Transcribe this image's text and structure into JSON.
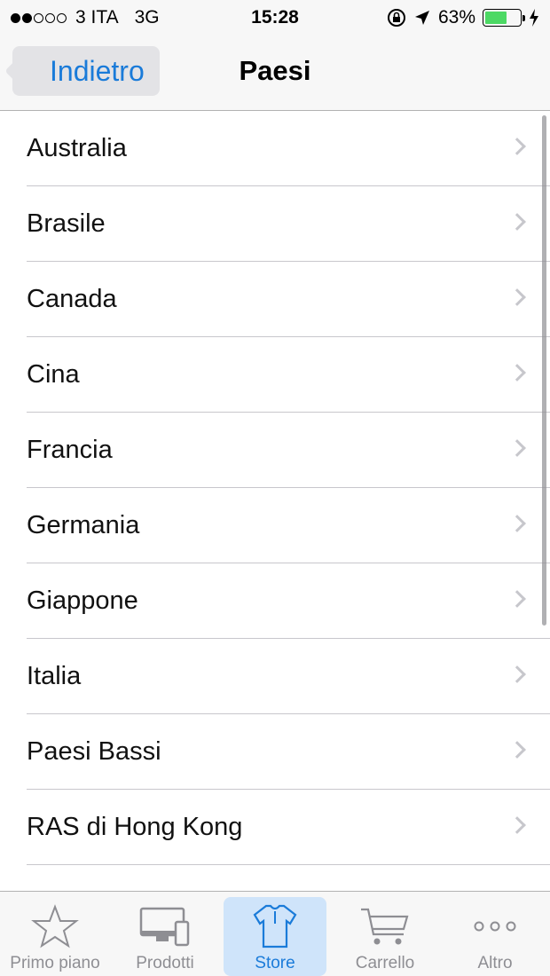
{
  "status_bar": {
    "carrier": "3 ITA",
    "network": "3G",
    "time": "15:28",
    "battery_percent": "63%",
    "battery_level": 0.63,
    "signal_bars_filled": 2,
    "signal_bars_total": 5
  },
  "nav": {
    "back_label": "Indietro",
    "title": "Paesi"
  },
  "countries": [
    "Australia",
    "Brasile",
    "Canada",
    "Cina",
    "Francia",
    "Germania",
    "Giappone",
    "Italia",
    "Paesi Bassi",
    "RAS di Hong Kong"
  ],
  "tabs": [
    {
      "label": "Primo piano",
      "icon": "star-icon",
      "active": false
    },
    {
      "label": "Prodotti",
      "icon": "devices-icon",
      "active": false
    },
    {
      "label": "Store",
      "icon": "shirt-icon",
      "active": true
    },
    {
      "label": "Carrello",
      "icon": "cart-icon",
      "active": false
    },
    {
      "label": "Altro",
      "icon": "more-icon",
      "active": false
    }
  ],
  "colors": {
    "accent": "#1a7bd9",
    "battery": "#4cd964",
    "active_tab_bg": "#cfe4fa"
  }
}
